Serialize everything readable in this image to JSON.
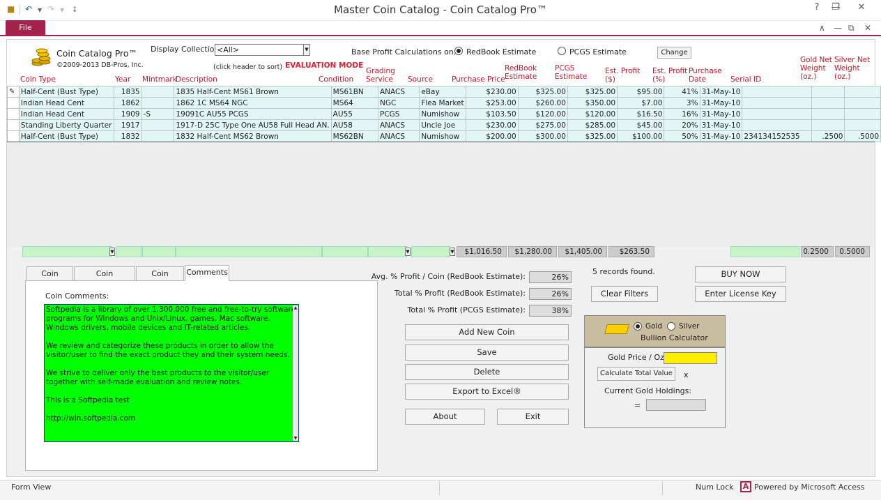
{
  "window": {
    "title": "Master Coin Catalog  -  Coin Catalog Pro™",
    "help_label": "?",
    "minimize_label": "—",
    "restore_label": "❐",
    "close_label": "✕"
  },
  "ribbon": {
    "file_label": "File",
    "caret_label": "∧",
    "doc_restore_label": "⧉",
    "doc_close_label": "✕"
  },
  "header": {
    "app_name": "Coin Catalog Pro™",
    "copyright": "©2009-2013 DB-Pros, Inc.",
    "display_collection_label": "Display Collection:",
    "display_collection_value": "<All>",
    "sort_hint": "(click header to sort)",
    "mode_label": "EVALUATION MODE",
    "profit_calc_label": "Base Profit Calculations on:",
    "redbook_option": "RedBook Estimate",
    "pcgs_option": "PCGS Estimate",
    "selected_option": "RedBook Estimate",
    "change_label": "Change"
  },
  "columns": {
    "coin_type": "Coin Type",
    "year": "Year",
    "mintmark": "Mintmark",
    "description": "Description",
    "condition": "Condition",
    "grading": [
      "Grading",
      "Service"
    ],
    "source": "Source",
    "purchase_price": "Purchase Price",
    "redbook": [
      "RedBook",
      "Estimate"
    ],
    "pcgs": [
      "PCGS",
      "Estimate"
    ],
    "est_profit_usd": [
      "Est. Profit",
      "($)"
    ],
    "est_profit_pct": [
      "Est. Profit",
      "(%)"
    ],
    "purchase_date": [
      "Purchase",
      "Date"
    ],
    "serial_id": "Serial ID",
    "gold_net": [
      "Gold Net",
      "Weight",
      "(oz.)"
    ],
    "silver_net": [
      "Silver Net",
      "Weight",
      "(oz.)"
    ]
  },
  "rows": [
    {
      "coin_type": "Half-Cent (Bust Type)",
      "year": "1835",
      "mintmark": "",
      "description": "1835 Half-Cent MS61 Brown",
      "condition": "MS61BN",
      "grading": "ANACS",
      "source": "eBay",
      "purchase_price": "$230.00",
      "redbook": "$325.00",
      "pcgs": "$325.00",
      "est_profit_usd": "$95.00",
      "est_profit_pct": "41%",
      "purchase_date": "31-May-10",
      "serial_id": "",
      "gold_net": "",
      "silver_net": ""
    },
    {
      "coin_type": "Indian Head Cent",
      "year": "1862",
      "mintmark": "",
      "description": "1862 1C MS64 NGC",
      "condition": "MS64",
      "grading": "NGC",
      "source": "Flea Market",
      "purchase_price": "$253.00",
      "redbook": "$260.00",
      "pcgs": "$350.00",
      "est_profit_usd": "$7.00",
      "est_profit_pct": "3%",
      "purchase_date": "31-May-10",
      "serial_id": "",
      "gold_net": "",
      "silver_net": ""
    },
    {
      "coin_type": "Indian Head Cent",
      "year": "1909",
      "mintmark": "-S",
      "description": "19091C AU55 PCGS",
      "condition": "AU55",
      "grading": "PCGS",
      "source": "Numishow",
      "purchase_price": "$103.50",
      "redbook": "$120.00",
      "pcgs": "$120.00",
      "est_profit_usd": "$16.50",
      "est_profit_pct": "16%",
      "purchase_date": "31-May-10",
      "serial_id": "",
      "gold_net": "",
      "silver_net": ""
    },
    {
      "coin_type": "Standing Liberty Quarter",
      "year": "1917",
      "mintmark": "",
      "description": "1917-D 25C Type One AU58 Full Head AN.",
      "condition": "AU58",
      "grading": "ANACS",
      "source": "Uncle Joe",
      "purchase_price": "$230.00",
      "redbook": "$275.00",
      "pcgs": "$285.00",
      "est_profit_usd": "$45.00",
      "est_profit_pct": "20%",
      "purchase_date": "31-May-10",
      "serial_id": "",
      "gold_net": "",
      "silver_net": ""
    },
    {
      "coin_type": "Half-Cent (Bust Type)",
      "year": "1832",
      "mintmark": "",
      "description": "1832 Half-Cent MS62 Brown",
      "condition": "MS62BN",
      "grading": "ANACS",
      "source": "Numishow",
      "purchase_price": "$200.00",
      "redbook": "$300.00",
      "pcgs": "$325.00",
      "est_profit_usd": "$100.00",
      "est_profit_pct": "50%",
      "purchase_date": "31-May-10",
      "serial_id": "234134152535",
      "gold_net": ".2500",
      "silver_net": ".5000"
    }
  ],
  "totals": {
    "purchase_price": "$1,016.50",
    "redbook": "$1,280.00",
    "pcgs": "$1,405.00",
    "est_profit_usd": "$263.50",
    "gold_net": "0.2500",
    "silver_net": "0.5000"
  },
  "tabs": [
    "Coin Details",
    "Coin Documents",
    "Coin Images",
    "Comments"
  ],
  "active_tab": "Comments",
  "comments": {
    "label": "Coin Comments:",
    "paragraphs": [
      "Softpedia is a library of over 1,300,000 free and free-to-try software programs for Windows and Unix/Linux, games, Mac software, Windows drivers, mobile devices and IT-related articles.",
      "We review and categorize these products in order to allow the visitor/user to find the exact product they and their system needs.",
      "We strive to deliver only the best products to the visitor/user together with self-made evaluation and review notes.",
      "This is a Softpedia test",
      "http://win.softpedia.com"
    ]
  },
  "stats": {
    "avg_profit_label": "Avg. % Profit / Coin (RedBook Estimate):",
    "avg_profit_value": "26%",
    "total_redbook_label": "Total % Profit (RedBook Estimate):",
    "total_redbook_value": "26%",
    "total_pcgs_label": "Total % Profit (PCGS Estimate):",
    "total_pcgs_value": "38%",
    "records_found": "5 records found."
  },
  "buttons": {
    "add_new_coin": "Add New Coin",
    "save": "Save",
    "delete": "Delete",
    "export_excel": "Export to Excel®",
    "about": "About",
    "exit": "Exit",
    "clear_filters": "Clear Filters",
    "buy_now": "BUY NOW",
    "enter_license": "Enter License Key"
  },
  "bullion": {
    "gold_option": "Gold",
    "silver_option": "Silver",
    "selected": "Gold",
    "title": "Bullion Calculator",
    "gold_price_label": "Gold Price / Oz.:",
    "gold_price_value": "",
    "calc_button": "Calculate Total Value",
    "x_label": "x",
    "holdings_label": "Current Gold Holdings:",
    "equals_label": "=",
    "holdings_value": ""
  },
  "statusbar": {
    "view": "Form View",
    "num_lock": "Num Lock",
    "powered_by": "Powered by Microsoft Access",
    "access_icon_glyph": "A"
  },
  "colors": {
    "accent": "#a4224b",
    "header_red": "#c0182b",
    "comments_bg": "#00ff00",
    "gold_input": "#ffee00",
    "totals_green": "#c8f2c8"
  }
}
